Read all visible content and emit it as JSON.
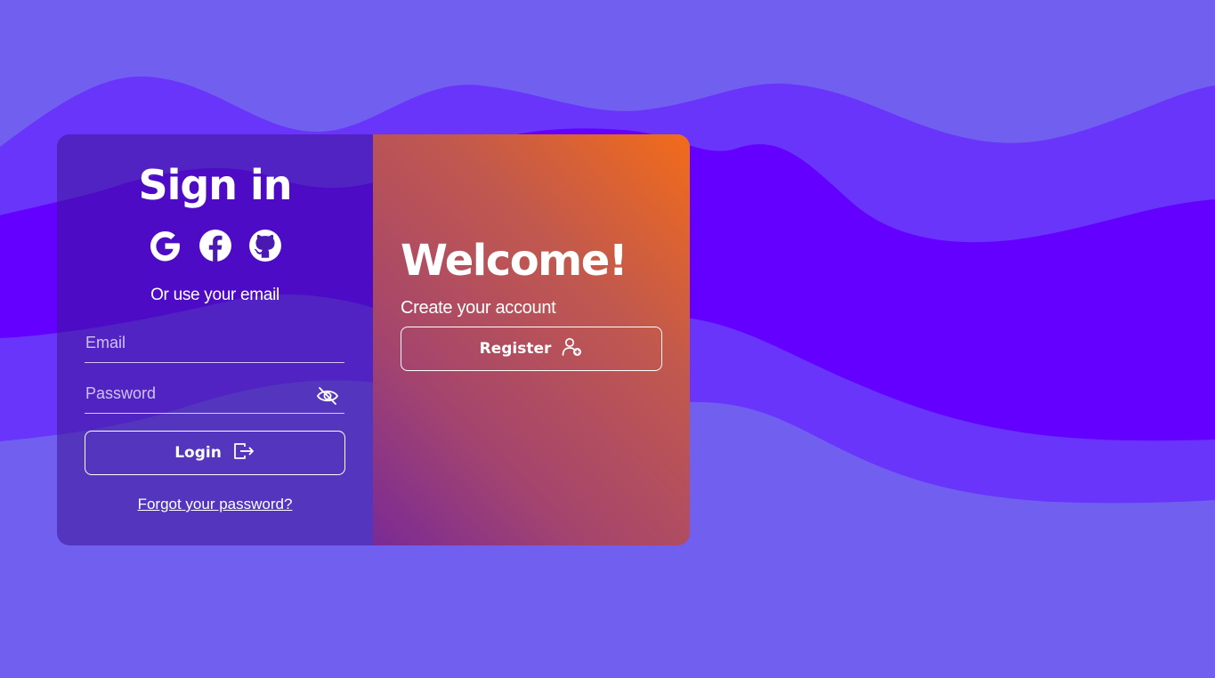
{
  "signin": {
    "title": "Sign in",
    "social_icons": [
      "google-icon",
      "facebook-icon",
      "github-icon"
    ],
    "or_text": "Or use your email",
    "email_placeholder": "Email",
    "email_value": "",
    "password_placeholder": "Password",
    "password_value": "",
    "login_label": "Login",
    "forgot_label": "Forgot your password?"
  },
  "welcome": {
    "title": "Welcome!",
    "subtitle": "Create your account",
    "register_label": "Register"
  },
  "colors": {
    "background": "#7160f0",
    "wave_mid": "#6a35fb",
    "wave_deep": "#6400ff",
    "gradient_top": "#f26b1a",
    "gradient_bottom": "#7a2a96"
  }
}
